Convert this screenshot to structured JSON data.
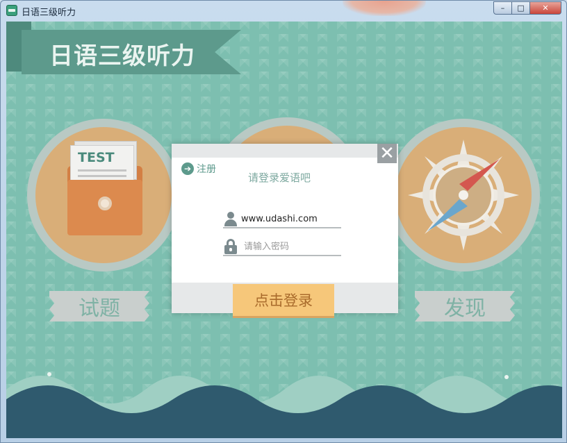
{
  "window": {
    "title": "日语三级听力",
    "minimize": "–",
    "maximize": "□",
    "close": "✕"
  },
  "app": {
    "banner_title": "日语三级听力",
    "test_card_label": "TEST",
    "menu": [
      {
        "label": "试题"
      },
      {
        "label": "发现"
      }
    ]
  },
  "login_dialog": {
    "register_label": "注册",
    "heading": "请登录爱语吧",
    "username_value": "www.udashi.com",
    "password_placeholder": "请输入密码",
    "login_button": "点击登录",
    "close_glyph": "✕"
  },
  "colors": {
    "background": "#7dbfb0",
    "banner": "#5d9a8c",
    "circle": "#d9ae78",
    "login_button": "#f6c77a",
    "wave": "#2f5a6e"
  }
}
